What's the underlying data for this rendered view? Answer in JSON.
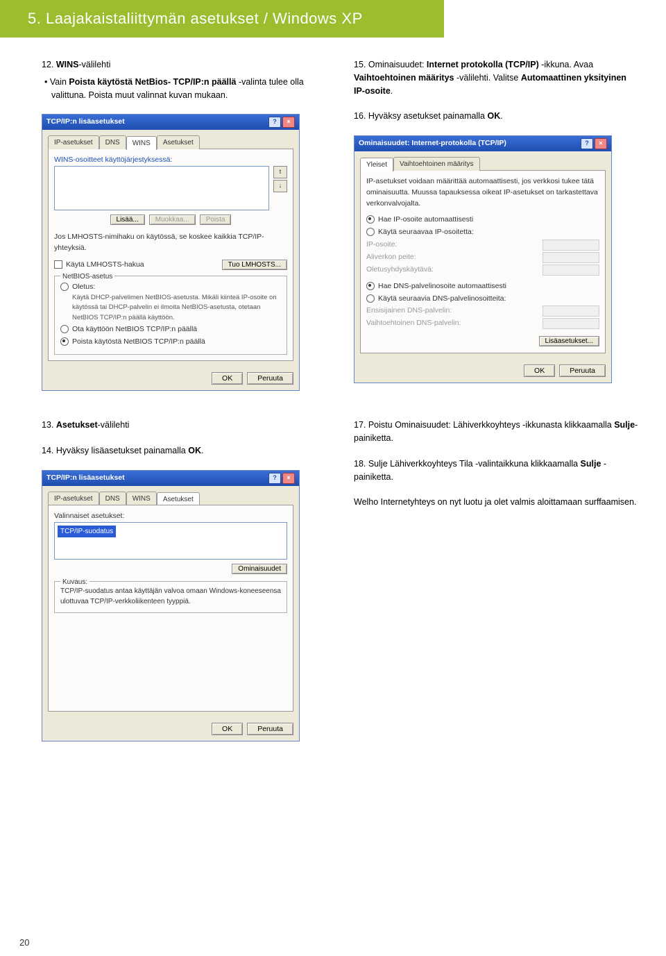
{
  "header": "5. Laajakaistaliittymän asetukset / Windows XP",
  "left": {
    "step12": {
      "lead": "12. ",
      "bold1": "WINS",
      "rest1": "-välilehti",
      "bullet_pre": "• Vain ",
      "bullet_bold": "Poista käytöstä NetBios- TCP/IP:n päällä",
      "bullet_rest": " -valinta tulee olla valittuna. Poista muut valinnat kuvan mukaan."
    },
    "step13": {
      "lead": "13. ",
      "bold": "Asetukset",
      "rest": "-välilehti"
    },
    "step14": "14. Hyväksy lisäasetukset painamalla ",
    "step14_bold": "OK",
    "step14_end": "."
  },
  "right": {
    "step15": {
      "lead": "15. Ominaisuudet: ",
      "bold1": "Internet protokolla (TCP/IP)",
      "mid": " -ikkuna. Avaa ",
      "bold2": "Vaihtoehtoinen määritys",
      "mid2": " -välilehti. Valitse ",
      "bold3": "Automaattinen yksityinen IP-osoite",
      "end": "."
    },
    "step16": "16. Hyväksy asetukset painamalla ",
    "step16_bold": "OK",
    "step16_end": ".",
    "step17": {
      "lead": "17. Poistu Ominaisuudet: Lähiverkkoyhteys -ikkunasta klikkaamalla ",
      "bold": "Sulje",
      "end": "-painiketta."
    },
    "step18": {
      "lead": "18. Sulje Lähiverkkoyhteys Tila -valintaikkuna klikkaamalla ",
      "bold": "Sulje",
      "end": " -painiketta."
    },
    "final": "Welho Internetyhteys on nyt luotu ja olet valmis aloittamaan surffaamisen."
  },
  "dlg1": {
    "title": "TCP/IP:n lisäasetukset",
    "tabs": [
      "IP-asetukset",
      "DNS",
      "WINS",
      "Asetukset"
    ],
    "wins_label": "WINS-osoitteet käyttöjärjestyksessä:",
    "btn_add": "Lisää...",
    "btn_edit": "Muokkaa...",
    "btn_del": "Poista",
    "lmhosts_note": "Jos LMHOSTS-nimihaku on käytössä, se koskee kaikkia TCP/IP-yhteyksiä.",
    "chk_lmhosts": "Käytä LMHOSTS-hakua",
    "btn_import": "Tuo LMHOSTS...",
    "group_netbios": "NetBIOS-asetus",
    "r_default": "Oletus:",
    "r_default_desc": "Käytä DHCP-palvelimen NetBIOS-asetusta. Mikäli kiinteä IP-osoite on käytössä tai DHCP-palvelin ei ilmoita NetBIOS-asetusta, otetaan NetBIOS TCP/IP:n päällä käyttöön.",
    "r_enable": "Ota käyttöön NetBIOS TCP/IP:n päällä",
    "r_disable": "Poista käytöstä NetBIOS TCP/IP:n päällä",
    "ok": "OK",
    "cancel": "Peruuta"
  },
  "dlg2": {
    "title": "Ominaisuudet: Internet-protokolla (TCP/IP)",
    "tabs": [
      "Yleiset",
      "Vaihtoehtoinen määritys"
    ],
    "intro": "IP-asetukset voidaan määrittää automaattisesti, jos verkkosi tukee tätä ominaisuutta. Muussa tapauksessa oikeat IP-asetukset on tarkastettava verkonvalvojalta.",
    "r_ip_auto": "Hae IP-osoite automaattisesti",
    "r_ip_manual": "Käytä seuraavaa IP-osoitetta:",
    "lbl_ip": "IP-osoite:",
    "lbl_mask": "Aliverkon peite:",
    "lbl_gw": "Oletusyhdyskäytävä:",
    "r_dns_auto": "Hae DNS-palvelinosoite automaattisesti",
    "r_dns_manual": "Käytä seuraavia DNS-palvelinosoitteita:",
    "lbl_dns1": "Ensisijainen DNS-palvelin:",
    "lbl_dns2": "Vaihtoehtoinen DNS-palvelin:",
    "btn_adv": "Lisäasetukset...",
    "ok": "OK",
    "cancel": "Peruuta"
  },
  "dlg3": {
    "title": "TCP/IP:n lisäasetukset",
    "tabs": [
      "IP-asetukset",
      "DNS",
      "WINS",
      "Asetukset"
    ],
    "opt_label": "Valinnaiset asetukset:",
    "sel": "TCP/IP-suodatus",
    "btn_props": "Ominaisuudet",
    "group_desc": "Kuvaus:",
    "desc": "TCP/IP-suodatus antaa käyttäjän valvoa omaan Windows-koneeseensa ulottuvaa TCP/IP-verkkoliikenteen tyyppiä.",
    "ok": "OK",
    "cancel": "Peruuta"
  },
  "pagenum": "20"
}
